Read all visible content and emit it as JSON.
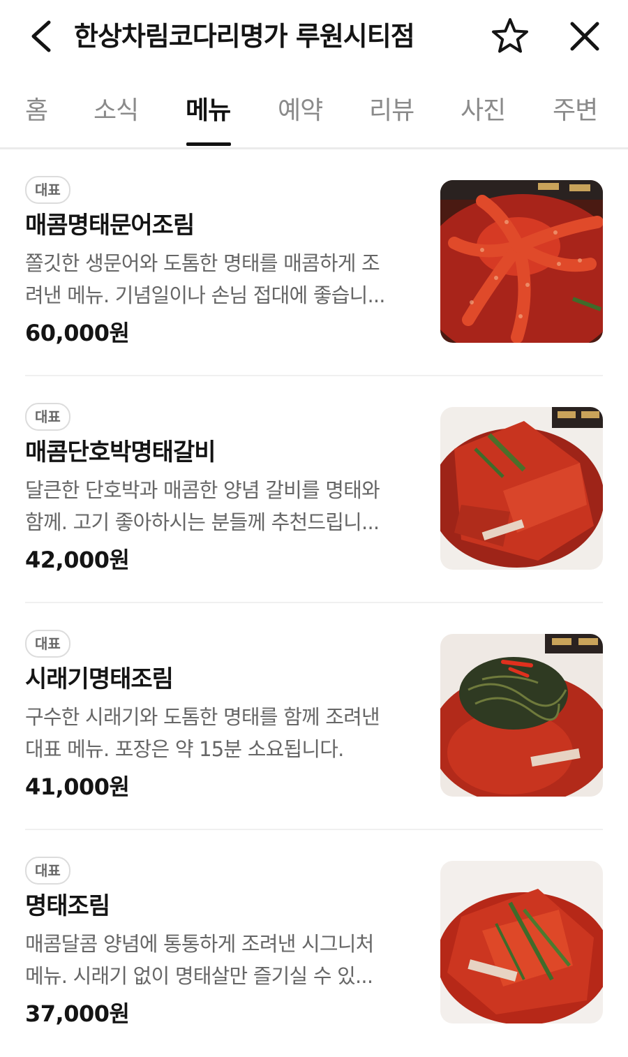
{
  "header": {
    "title": "한상차림코다리명가 루원시티점",
    "back_icon": "chevron-left-icon",
    "favorite_icon": "star-outline-icon",
    "close_icon": "close-icon"
  },
  "tabs": [
    {
      "label": "홈",
      "active": false
    },
    {
      "label": "소식",
      "active": false
    },
    {
      "label": "메뉴",
      "active": true
    },
    {
      "label": "예약",
      "active": false
    },
    {
      "label": "리뷰",
      "active": false
    },
    {
      "label": "사진",
      "active": false
    },
    {
      "label": "주변",
      "active": false
    }
  ],
  "menu": {
    "items": [
      {
        "badge": "대표",
        "name": "매콤명태문어조림",
        "desc_line1": "쫄깃한 생문어와 도톰한 명태를 매콤하게 조",
        "desc_line2": "려낸 메뉴. 기념일이나 손님 접대에 좋습니...",
        "price": "60,000원"
      },
      {
        "badge": "대표",
        "name": "매콤단호박명태갈비",
        "desc_line1": "달큰한 단호박과 매콤한 양념 갈비를 명태와",
        "desc_line2": "함께. 고기 좋아하시는 분들께 추천드립니...",
        "price": "42,000원"
      },
      {
        "badge": "대표",
        "name": "시래기명태조림",
        "desc_line1": "구수한 시래기와 도톰한 명태를 함께 조려낸",
        "desc_line2": "대표 메뉴. 포장은 약 15분 소요됩니다.",
        "price": "41,000원"
      },
      {
        "badge": "대표",
        "name": "명태조림",
        "desc_line1": "매콤달콤 양념에 통통하게 조려낸 시그니처",
        "desc_line2": "메뉴. 시래기 없이 명태살만 즐기실 수 있...",
        "price": "37,000원"
      }
    ]
  },
  "colors": {
    "text_primary": "#141414",
    "text_secondary": "#666666",
    "tab_inactive": "#8a8a8a",
    "divider": "#f0f0f0",
    "food_red": "#c42a1a"
  }
}
